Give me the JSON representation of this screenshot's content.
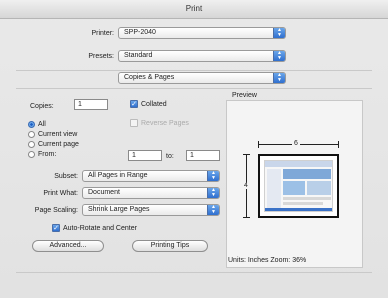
{
  "window": {
    "title": "Print"
  },
  "printer": {
    "label": "Printer:",
    "value": "SPP-2040"
  },
  "presets": {
    "label": "Presets:",
    "value": "Standard"
  },
  "pane": {
    "value": "Copies & Pages"
  },
  "copies": {
    "label": "Copies:",
    "value": "1",
    "collated_label": "Collated",
    "collated": true,
    "reverse_label": "Reverse Pages",
    "reverse": false
  },
  "pages": {
    "options": [
      "All",
      "Current view",
      "Current page",
      "From:"
    ],
    "selected": "All",
    "from_value": "1",
    "to_label": "to:",
    "to_value": "1"
  },
  "subset": {
    "label": "Subset:",
    "value": "All Pages in Range"
  },
  "print_what": {
    "label": "Print What:",
    "value": "Document"
  },
  "page_scaling": {
    "label": "Page Scaling:",
    "value": "Shrink Large Pages"
  },
  "auto_rotate": {
    "label": "Auto-Rotate and Center",
    "checked": true
  },
  "preview": {
    "title": "Preview",
    "width_label": "6",
    "height_label": "4",
    "units_text": "Units: Inches  Zoom:  36%"
  },
  "buttons": {
    "advanced": "Advanced...",
    "printing_tips": "Printing Tips"
  }
}
